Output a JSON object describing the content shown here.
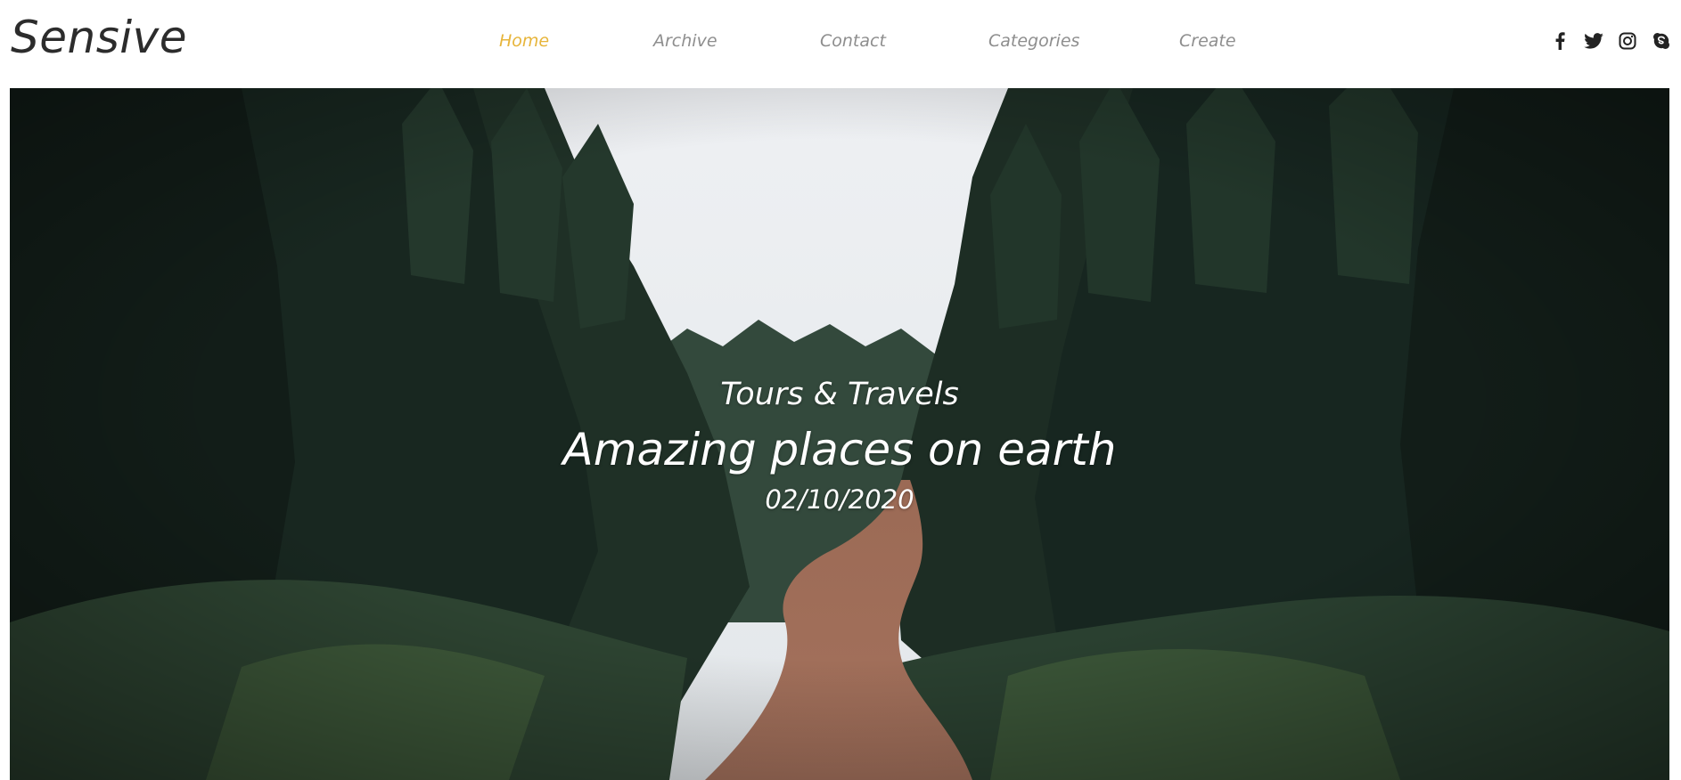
{
  "brand": {
    "logo_text": "Sensive"
  },
  "nav": {
    "items": [
      {
        "label": "Home",
        "active": true
      },
      {
        "label": "Archive",
        "active": false
      },
      {
        "label": "Contact",
        "active": false
      },
      {
        "label": "Categories",
        "active": false
      },
      {
        "label": "Create",
        "active": false
      }
    ]
  },
  "social": {
    "icons": [
      "facebook-icon",
      "twitter-icon",
      "instagram-icon",
      "skype-icon"
    ]
  },
  "hero": {
    "category": "Tours & Travels",
    "title": "Amazing places on earth",
    "date": "02/10/2020"
  },
  "colors": {
    "accent": "#e7b53b",
    "nav_text": "#8e8e8e",
    "logo_text": "#2c2c2c",
    "hero_text": "#ffffff"
  }
}
